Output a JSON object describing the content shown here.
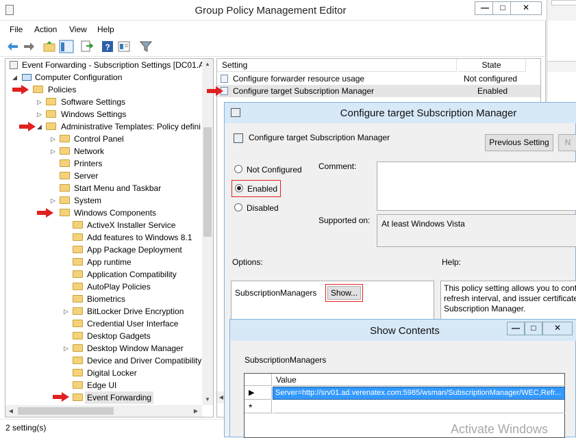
{
  "gpme": {
    "title": "Group Policy Management Editor",
    "menu": [
      "File",
      "Action",
      "View",
      "Help"
    ],
    "status": "2 setting(s)",
    "tree": {
      "root": "Event Forwarding - Subscription Settings [DC01.AI",
      "computer_config": "Computer Configuration",
      "policies": "Policies",
      "software_settings": "Software Settings",
      "windows_settings": "Windows Settings",
      "admin_templates": "Administrative Templates: Policy defini",
      "control_panel": "Control Panel",
      "network": "Network",
      "printers": "Printers",
      "server": "Server",
      "start_menu": "Start Menu and Taskbar",
      "system": "System",
      "windows_components": "Windows Components",
      "components": [
        "ActiveX Installer Service",
        "Add features to Windows 8.1",
        "App Package Deployment",
        "App runtime",
        "Application Compatibility",
        "AutoPlay Policies",
        "Biometrics",
        "BitLocker Drive Encryption",
        "Credential User Interface",
        "Desktop Gadgets",
        "Desktop Window Manager",
        "Device and Driver Compatibility",
        "Digital Locker",
        "Edge UI",
        "Event Forwarding"
      ]
    },
    "list": {
      "col_setting": "Setting",
      "col_state": "State",
      "rows": [
        {
          "setting": "Configure forwarder resource usage",
          "state": "Not configured"
        },
        {
          "setting": "Configure target Subscription Manager",
          "state": "Enabled"
        }
      ]
    }
  },
  "policy_dialog": {
    "title": "Configure target Subscription Manager",
    "header": "Configure target Subscription Manager",
    "previous_setting": "Previous Setting",
    "next_setting": "N",
    "not_configured": "Not Configured",
    "enabled": "Enabled",
    "disabled": "Disabled",
    "comment_label": "Comment:",
    "supported_on_label": "Supported on:",
    "supported_on_value": "At least Windows Vista",
    "options_label": "Options:",
    "help_label": "Help:",
    "option_name": "SubscriptionManagers",
    "show_button": "Show...",
    "help_text_1": "This policy setting allows you to conf",
    "help_text_2": "refresh interval, and issuer certificate",
    "help_text_3": "Subscription Manager."
  },
  "show_contents": {
    "title": "Show Contents",
    "label": "SubscriptionManagers",
    "col_value": "Value",
    "row_value": "Server=http://srv01.ad.verenatex.com:5985/wsman/SubscriptionManager/WEC,Refr...",
    "new_row_marker": "*"
  },
  "watermark": "Activate Windows",
  "colors": {
    "accent": "#3399ff",
    "annotation_red": "#e02020",
    "dialog_frame": "#7fb4e2",
    "selected_row": "#3399ff"
  }
}
